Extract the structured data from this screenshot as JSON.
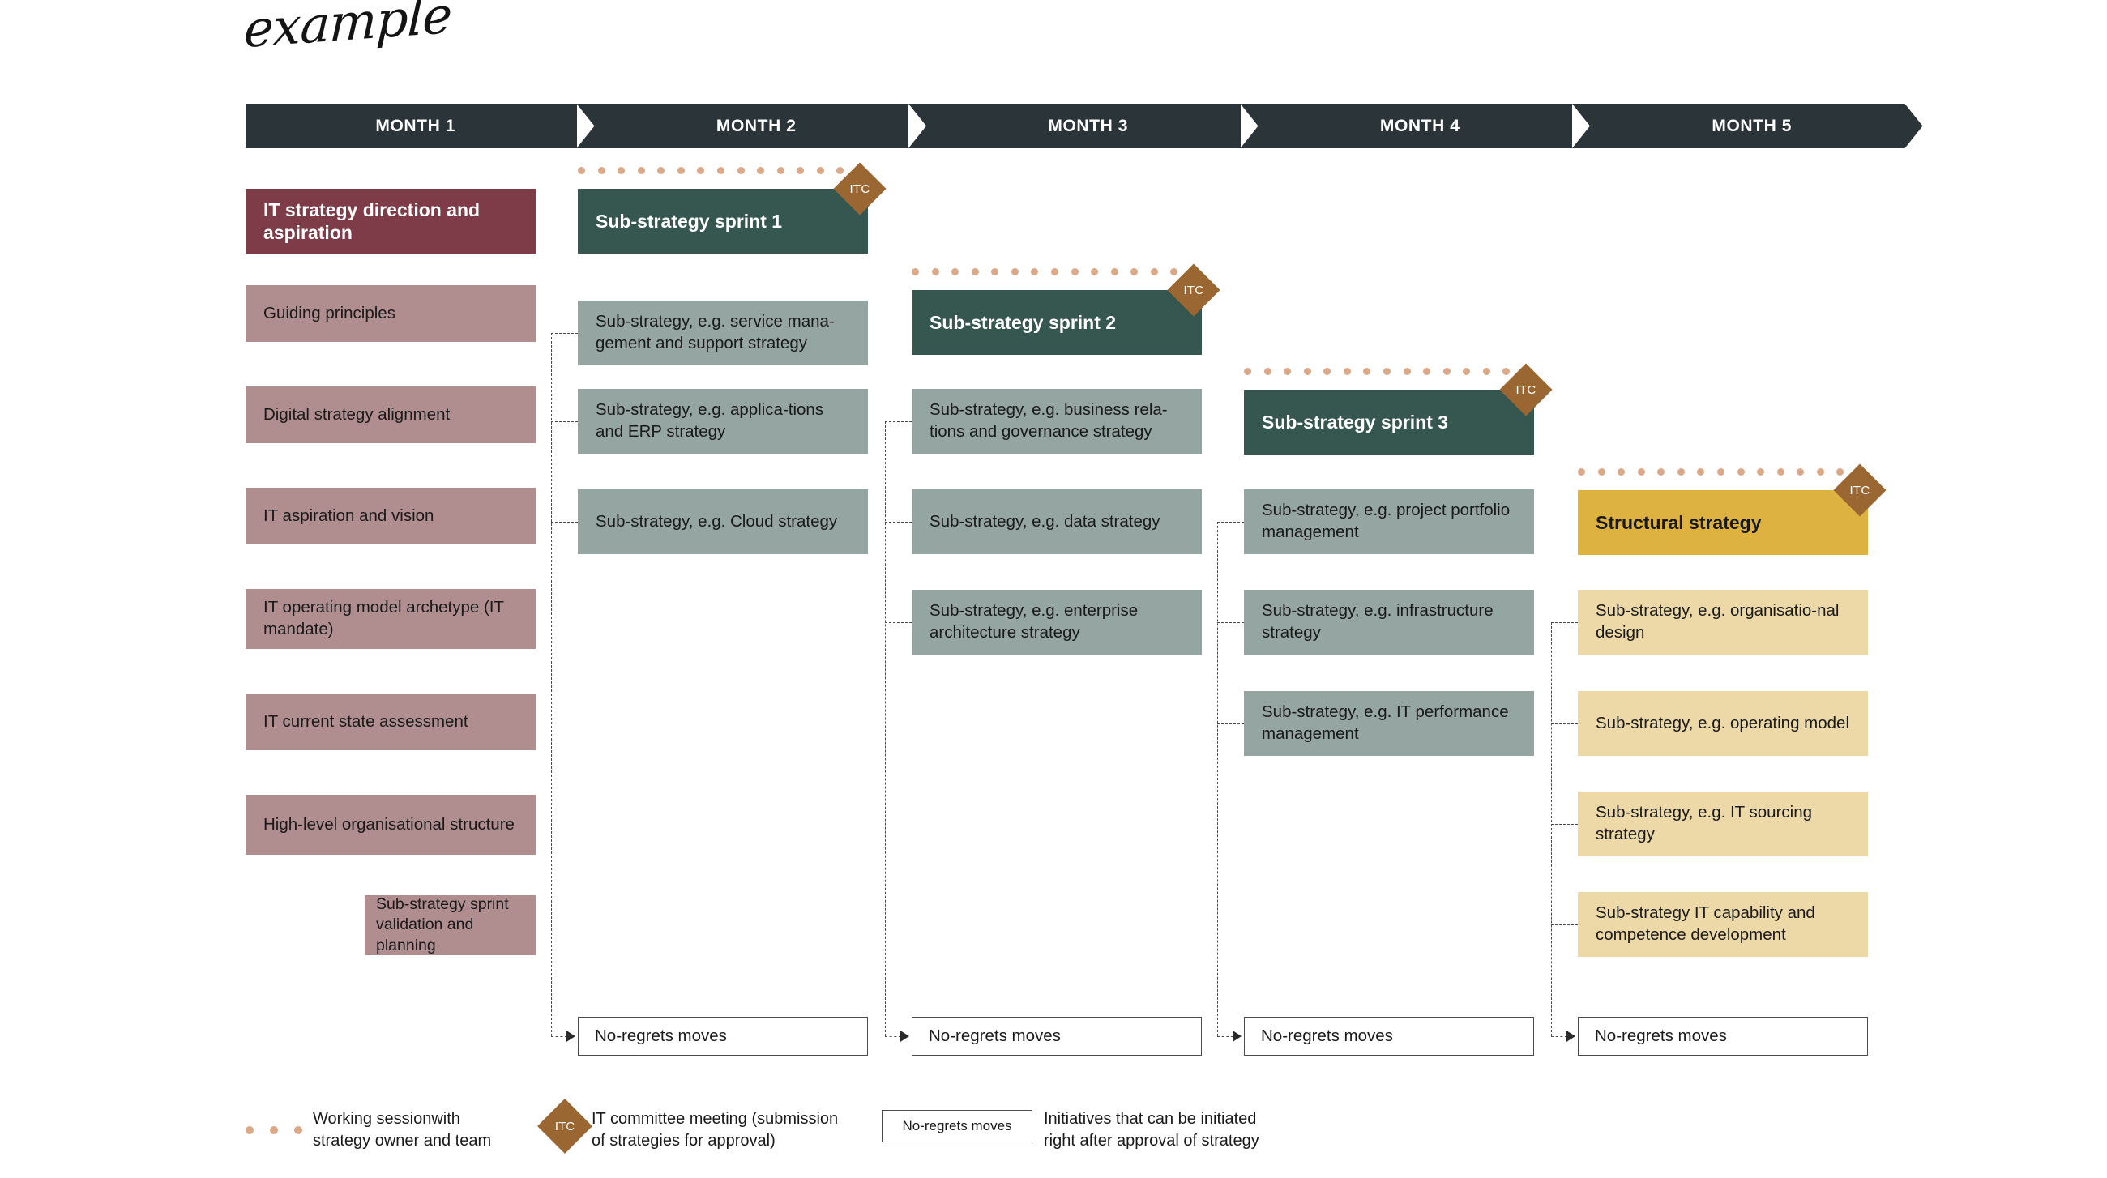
{
  "title": "example",
  "timeline": {
    "months": [
      "MONTH 1",
      "MONTH 2",
      "MONTH 3",
      "MONTH 4",
      "MONTH 5"
    ]
  },
  "colors": {
    "header_bar": "#2b3539",
    "maroon": "#7d3c47",
    "rose": "#b08e90",
    "teal": "#36574f",
    "sage": "#95a5a1",
    "gold": "#deb240",
    "sand": "#ecd9a7",
    "itc_bronze": "#9a6733",
    "dot_peach": "#dba888"
  },
  "columns": [
    {
      "id": "month1",
      "header": "IT strategy direction and aspiration",
      "header_style": "maroon",
      "has_itc": false,
      "has_dots": false,
      "items": [
        "Guiding principles",
        "Digital strategy alignment",
        "IT aspiration and vision",
        "IT operating model archetype (IT mandate)",
        "IT current state assessment",
        "High-level organisational structure"
      ],
      "offset_item": "Sub-strategy sprint validation and planning",
      "no_regrets": null
    },
    {
      "id": "month2",
      "header": "Sub-strategy sprint 1",
      "header_style": "teal",
      "has_itc": true,
      "itc_label": "ITC",
      "has_dots": true,
      "items": [
        "Sub-strategy, e.g. service mana-gement and support strategy",
        "Sub-strategy, e.g. applica-tions and ERP strategy",
        "Sub-strategy, e.g. Cloud strategy"
      ],
      "no_regrets": "No-regrets moves"
    },
    {
      "id": "month3",
      "header": "Sub-strategy sprint 2",
      "header_style": "teal",
      "has_itc": true,
      "itc_label": "ITC",
      "has_dots": true,
      "items": [
        "Sub-strategy, e.g. business rela-tions and governance strategy",
        "Sub-strategy, e.g. data strategy",
        "Sub-strategy, e.g. enterprise architecture strategy"
      ],
      "no_regrets": "No-regrets moves"
    },
    {
      "id": "month4",
      "header": "Sub-strategy sprint 3",
      "header_style": "teal",
      "has_itc": true,
      "itc_label": "ITC",
      "has_dots": true,
      "items": [
        "Sub-strategy, e.g. project portfolio management",
        "Sub-strategy, e.g. infrastructure strategy",
        "Sub-strategy, e.g. IT performance management"
      ],
      "no_regrets": "No-regrets moves"
    },
    {
      "id": "month5",
      "header": "Structural strategy",
      "header_style": "gold",
      "has_itc": true,
      "itc_label": "ITC",
      "has_dots": true,
      "items": [
        "Sub-strategy, e.g. organisatio-nal design",
        "Sub-strategy, e.g. operating model",
        "Sub-strategy, e.g. IT sourcing strategy",
        "Sub-strategy IT capability and competence development"
      ],
      "no_regrets": "No-regrets moves"
    }
  ],
  "legend": [
    {
      "id": "working-session",
      "marker": "dots",
      "text": "Working sessionwith\nstrategy owner and team"
    },
    {
      "id": "itc-meeting",
      "marker": "diamond",
      "marker_label": "ITC",
      "text": "IT committee meeting (submission\nof strategies for approval)"
    },
    {
      "id": "no-regrets",
      "marker": "box",
      "marker_label": "No-regrets moves",
      "text": "Initiatives that can be initiated\nright after approval of strategy"
    }
  ]
}
